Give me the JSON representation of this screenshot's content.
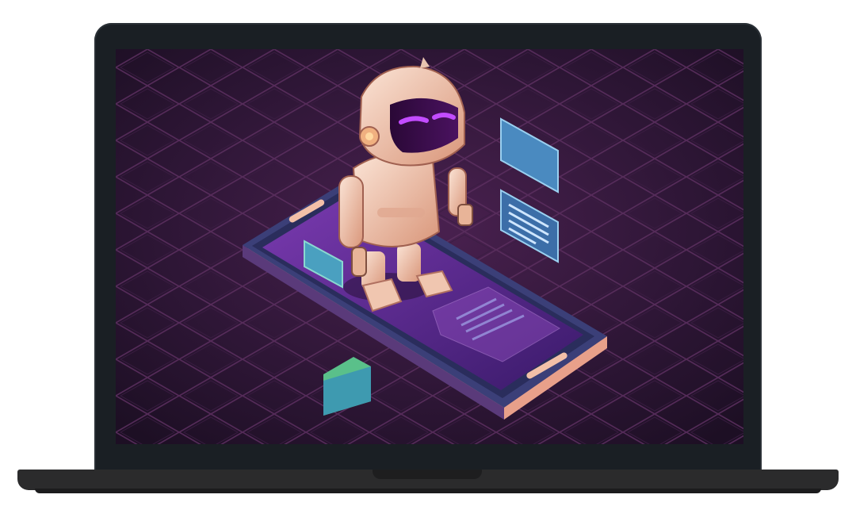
{
  "scene": {
    "subject": "robot-on-smartphone-illustration",
    "device_frame": "laptop",
    "colors": {
      "background": "#2d1735",
      "grid_line": "#4a2a55",
      "grid_glow": "#7a3a5a",
      "phone_body": "#3b3f78",
      "phone_screen": "#5a2a8a",
      "phone_edge": "#e8a08a",
      "robot_body": "#f0c6b0",
      "robot_visor": "#3a0f4a",
      "robot_eyes": "#c24cff",
      "card_blue": "#4a8ac0",
      "card_green": "#5ac08a"
    }
  }
}
